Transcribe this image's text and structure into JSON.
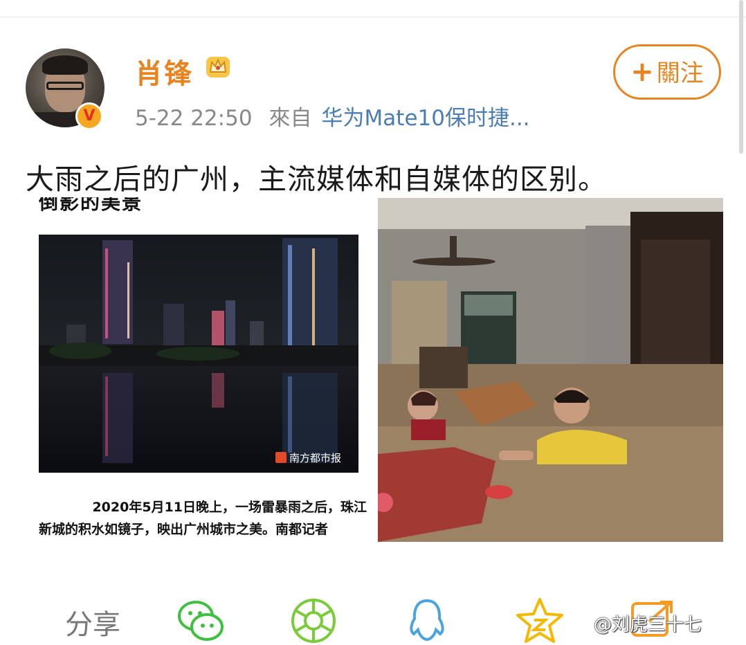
{
  "post": {
    "username": "肖锋",
    "timestamp": "5-22 22:50",
    "from_label": "來自",
    "source": "华为Mate10保时捷...",
    "follow_label": "關注",
    "follow_plus": "+",
    "text": "大雨之后的广州，主流媒体和自媒体的区别。"
  },
  "news_image": {
    "headline_fragment": "倒影的美景",
    "logo_text": "南方都市报",
    "caption_line1": "2020年5月11日晚上，一场雷暴雨之后，珠江",
    "caption_line2": "新城的积水如镜子，映出广州城市之美。南都记者"
  },
  "share": {
    "label": "分享",
    "icons": [
      "wechat-icon",
      "moments-icon",
      "qq-icon",
      "qzone-icon",
      "more-icon"
    ]
  },
  "watermark": "@刘虎三十七",
  "colors": {
    "accent": "#e8841f",
    "link": "#4a7db4",
    "wechat": "#3fbf3f",
    "qq": "#4aa3e0",
    "qzone": "#f5b800"
  }
}
